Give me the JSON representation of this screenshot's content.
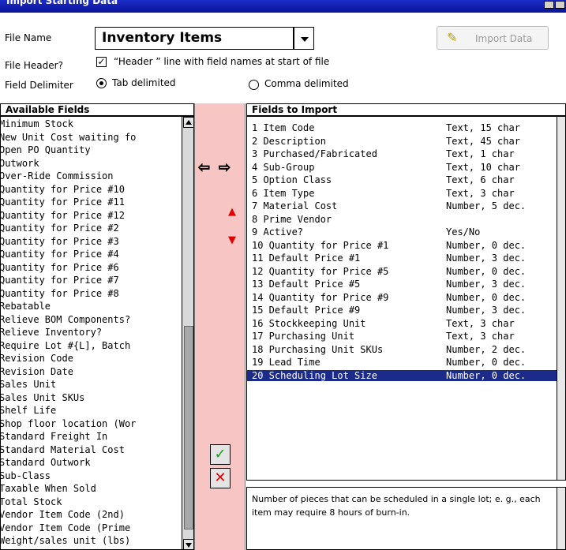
{
  "window": {
    "title": "Import Starting Data"
  },
  "form": {
    "file_name_label": "File Name",
    "file_name_value": "Inventory Items",
    "import_button_label": "Import Data",
    "file_header_label": "File Header?",
    "file_header_option": "“Header ” line with field names at start of file",
    "file_header_checked": true,
    "delimiter_label": "Field Delimiter",
    "delimiter_tab": "Tab delimited",
    "delimiter_comma": "Comma delimited",
    "delimiter_selected": "tab"
  },
  "available": {
    "title": "Available Fields",
    "items": [
      "Minimum Stock",
      "New Unit Cost waiting fo",
      "Open PO Quantity",
      "Outwork",
      "Over-Ride Commission",
      "Quantity for Price #10",
      "Quantity for Price #11",
      "Quantity for Price #12",
      "Quantity for Price #2",
      "Quantity for Price #3",
      "Quantity for Price #4",
      "Quantity for Price #6",
      "Quantity for Price #7",
      "Quantity for Price #8",
      "Rebatable",
      "Relieve BOM Components?",
      "Relieve Inventory?",
      "Require Lot #{L], Batch",
      "Revision Code",
      "Revision Date",
      "Sales Unit",
      "Sales Unit SKUs",
      "Shelf Life",
      "Shop floor location (Wor",
      "Standard Freight In",
      "Standard Material Cost",
      "Standard Outwork",
      "Sub-Class",
      "Taxable When Sold",
      "Total Stock",
      "Vendor Item Code (2nd)",
      "Vendor Item Code (Prime",
      "Weight/sales unit (lbs)"
    ]
  },
  "imports": {
    "title": "Fields to Import",
    "selected_index": 19,
    "items": [
      {
        "name": "1 Item Code",
        "type": "Text, 15 char"
      },
      {
        "name": "2 Description",
        "type": "Text, 45 char"
      },
      {
        "name": "3 Purchased/Fabricated",
        "type": "Text, 1 char"
      },
      {
        "name": "4 Sub-Group",
        "type": "Text, 10 char"
      },
      {
        "name": "5 Option Class",
        "type": "Text, 6 char"
      },
      {
        "name": "6 Item Type",
        "type": "Text, 3 char"
      },
      {
        "name": "7 Material Cost",
        "type": "Number, 5 dec."
      },
      {
        "name": "8 Prime Vendor",
        "type": ""
      },
      {
        "name": "9 Active?",
        "type": "Yes/No"
      },
      {
        "name": "10 Quantity for Price #1",
        "type": "Number, 0 dec."
      },
      {
        "name": "11 Default Price #1",
        "type": "Number, 3 dec."
      },
      {
        "name": "12 Quantity for Price #5",
        "type": "Number, 0 dec."
      },
      {
        "name": "13 Default Price #5",
        "type": "Number, 3 dec."
      },
      {
        "name": "14 Quantity for Price #9",
        "type": "Number, 0 dec."
      },
      {
        "name": "15 Default Price #9",
        "type": "Number, 3 dec."
      },
      {
        "name": "16 Stockkeeping Unit",
        "type": "Text, 3 char"
      },
      {
        "name": "17 Purchasing Unit",
        "type": "Text, 3 char"
      },
      {
        "name": "18 Purchasing Unit SKUs",
        "type": "Number, 2 dec."
      },
      {
        "name": "19 Lead Time",
        "type": "Number, 0 dec."
      },
      {
        "name": "20 Scheduling Lot Size",
        "type": "Number, 0 dec."
      }
    ]
  },
  "description": "Number of pieces that can be scheduled in a single lot; e. g., each item may require 8 hours of burn-in.",
  "colors": {
    "title_bar": "#1c2cc6",
    "center_strip": "#f8c5c5",
    "selection": "#1c2b8a",
    "accept": "#1aa01a",
    "cancel": "#e00000"
  }
}
